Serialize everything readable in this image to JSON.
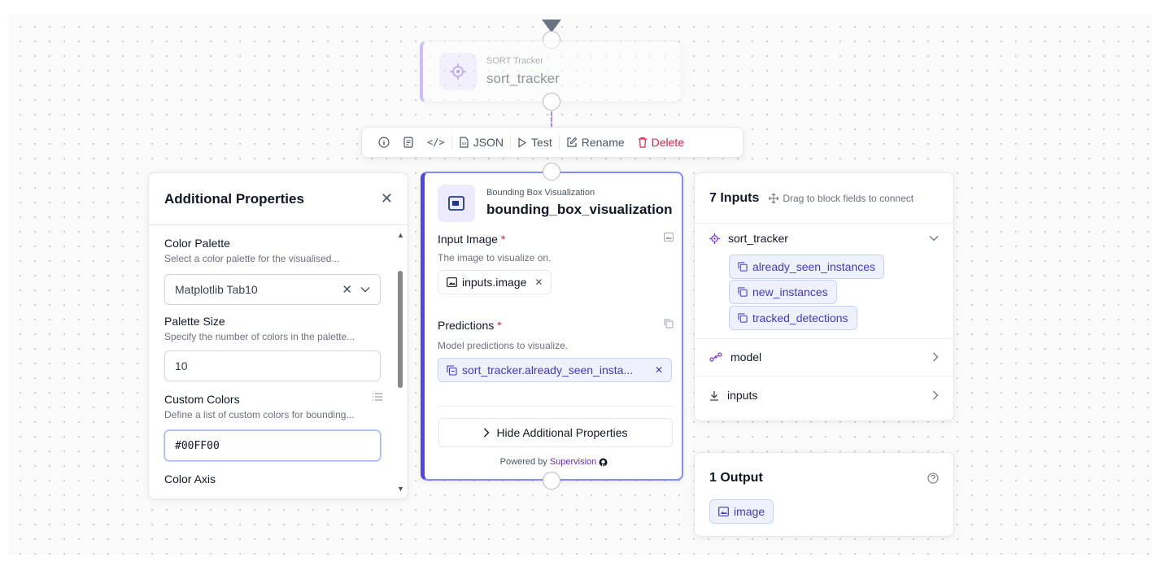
{
  "top_node": {
    "type_label": "SORT Tracker",
    "name": "sort_tracker"
  },
  "toolbar": {
    "json_label": "JSON",
    "test_label": "Test",
    "rename_label": "Rename",
    "delete_label": "Delete"
  },
  "additional_properties": {
    "title": "Additional Properties",
    "fields": [
      {
        "label": "Color Palette",
        "description": "Select a color palette for the visualised...",
        "value": "Matplotlib Tab10"
      },
      {
        "label": "Palette Size",
        "description": "Specify the number of colors in the palette...",
        "value": "10"
      },
      {
        "label": "Custom Colors",
        "description": "Define a list of custom colors for bounding...",
        "value": "#00FF00"
      },
      {
        "label": "Color Axis",
        "description": ""
      }
    ]
  },
  "main_node": {
    "type_label": "Bounding Box Visualization",
    "name": "bounding_box_visualization",
    "input_image": {
      "label": "Input Image",
      "required_mark": "*",
      "description": "The image to visualize on.",
      "value": "inputs.image"
    },
    "predictions": {
      "label": "Predictions",
      "required_mark": "*",
      "description": "Model predictions to visualize.",
      "value": "sort_tracker.already_seen_insta..."
    },
    "hide_button": "Hide Additional Properties",
    "powered_by": "Powered by",
    "powered_brand": "Supervision"
  },
  "inputs_panel": {
    "title": "7 Inputs",
    "hint": "Drag to block fields to connect",
    "groups": [
      {
        "name": "sort_tracker",
        "fields": [
          "already_seen_instances",
          "new_instances",
          "tracked_detections"
        ]
      },
      {
        "name": "model"
      },
      {
        "name": "inputs"
      }
    ]
  },
  "outputs_panel": {
    "title": "1 Output",
    "outputs": [
      "image"
    ]
  },
  "colors": {
    "accent": "#4f46e5",
    "delete": "#e11d48",
    "chip_bg": "#eef2ff"
  }
}
